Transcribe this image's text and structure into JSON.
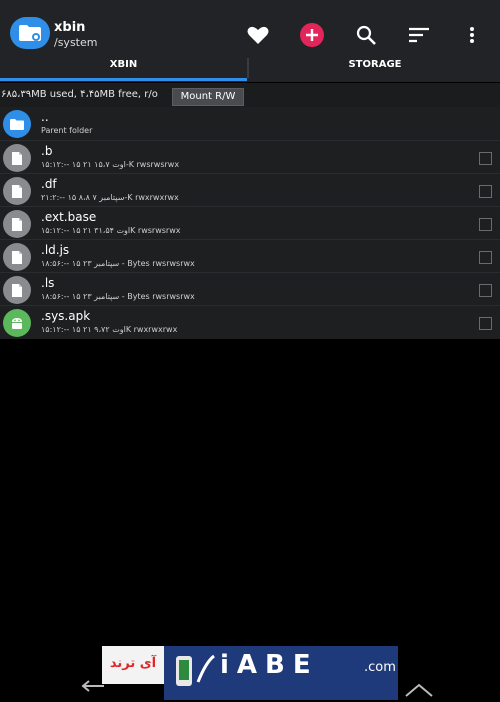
{
  "appbar": {
    "title": "xbin",
    "subtitle": "/system",
    "accent_color": "#2f8fe8",
    "add_color": "#e2265b",
    "icons": [
      "folder-icon",
      "heart-icon",
      "add-icon",
      "search-icon",
      "sort-icon",
      "more-icon"
    ]
  },
  "tabs": [
    {
      "label": "XBIN",
      "selected": true
    },
    {
      "label": "STORAGE",
      "selected": false
    }
  ],
  "info": {
    "text": "۶۸۵،۳۹MB used, ۴،۴۵MB free, r/o",
    "mount_label": "Mount R/W"
  },
  "files": [
    {
      "name": "..",
      "meta": "Parent folder",
      "icon": "folder-icon",
      "color": "#2f8fe8"
    },
    {
      "name": ".b",
      "meta": "۱۵:۱۲:-- ۱۵ ۲۱ اوت ۱۵،۷-K  rwsrwsrwx",
      "icon": "file-icon",
      "color": "#8a8b8e"
    },
    {
      "name": ".df",
      "meta": "۲۱:۲:-- ۱۵ سپتامبر ۷  ۸،۸-K  rwxrwxrwx",
      "icon": "file-icon",
      "color": "#8a8b8e"
    },
    {
      "name": ".ext.base",
      "meta": "۱۵:۱۲:-- ۱۵ ۲۱ اوت ۳۱،۵۴K  rwsrwsrwx",
      "icon": "file-icon",
      "color": "#8a8b8e"
    },
    {
      "name": ".ld.js",
      "meta": "۱۸:۵۶:-- ۱۵ سپتامبر ۲۳  - Bytes  rwsrwsrwx",
      "icon": "file-icon",
      "color": "#8a8b8e"
    },
    {
      "name": ".ls",
      "meta": "۱۸:۵۶:-- ۱۵ سپتامبر ۲۳  - Bytes  rwsrwsrwx",
      "icon": "file-icon",
      "color": "#8a8b8e"
    },
    {
      "name": ".sys.apk",
      "meta": "۱۵:۱۲:-- ۱۵ ۲۱ اوت ۹،۷۲K  rwxrwxrwx",
      "icon": "android-icon",
      "color": "#5cb85c"
    }
  ],
  "watermark": {
    "left_text": "آی ترند",
    "letters": "iABE",
    "domain": ".com"
  }
}
